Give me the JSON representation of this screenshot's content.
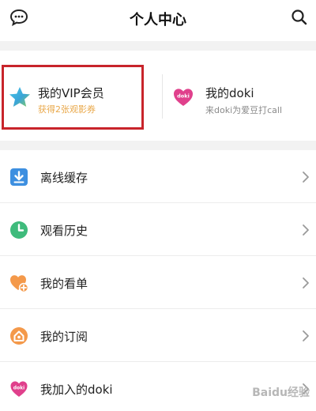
{
  "header": {
    "title": "个人中心",
    "message_icon": "message-bubble-icon",
    "search_icon": "search-icon"
  },
  "cards": [
    {
      "label": "我的VIP会员",
      "sub": "获得2张观影券",
      "icon": "vip-star-icon",
      "highlighted": true
    },
    {
      "label": "我的doki",
      "sub": "来doki为爱豆打call",
      "icon": "doki-heart-icon",
      "icon_text": "doki"
    }
  ],
  "menu": [
    {
      "label": "离线缓存",
      "icon": "download-icon",
      "color": "#3d8fe0"
    },
    {
      "label": "观看历史",
      "icon": "clock-icon",
      "color": "#3fbb7c"
    },
    {
      "label": "我的看单",
      "icon": "heart-plus-icon",
      "color": "#f4994a"
    },
    {
      "label": "我的订阅",
      "icon": "home-subscribe-icon",
      "color": "#f4994a"
    },
    {
      "label": "我加入的doki",
      "icon": "doki-heart-icon",
      "color": "#e0408c",
      "icon_text": "doki"
    }
  ],
  "colors": {
    "highlight_frame": "#c8242b",
    "vip_sub": "#e9a84a",
    "section_gap": "#f2f2f2"
  },
  "watermark": "Baidu经验"
}
